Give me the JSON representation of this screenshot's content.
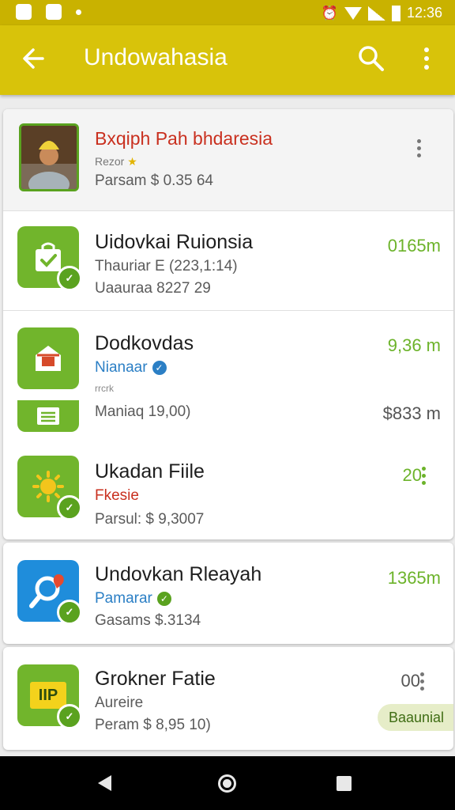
{
  "status_bar": {
    "time": "12:36"
  },
  "app_bar": {
    "title": "Undowahasia",
    "back_icon": "arrow-back-icon",
    "search_icon": "search-icon",
    "more_icon": "more-vert-icon"
  },
  "profile": {
    "name": "Bxqiph Pah bhdaresia",
    "sub": "Rezor",
    "price": "Parsam $ 0.35 64"
  },
  "group1": [
    {
      "name": "Uidovkai Ruionsia",
      "line2": "Thauriar E (223,1:14)",
      "line3": "Uaauraa 8227 29",
      "meta": "0165m",
      "icon": "shopping-bag-icon"
    },
    {
      "name": "Dodkovdas",
      "line2": "Nianaar",
      "line2b": "rrcrk",
      "line3": "Maniaq 19,00)",
      "meta": "9,36 m",
      "meta2": "$833 m",
      "icon": "store-icon"
    },
    {
      "name": "Ukadan Fiile",
      "line2": "Fkesie",
      "line3": "Parsul: $ 9,3007",
      "meta": "20",
      "icon": "sun-icon"
    }
  ],
  "card2": {
    "name": "Undovkan Rleayah",
    "line2": "Pamarar",
    "line3": "Gasams $.3134",
    "meta": "1365m",
    "icon": "location-search-icon"
  },
  "card3": {
    "name": "Grokner Fatie",
    "line2": "Aureire",
    "line3": "Peram $ 8,95 10)",
    "meta": "00",
    "pill": "Baaunial",
    "icon_text": "IIP"
  },
  "colors": {
    "app_bar": "#d8c30a",
    "status_bar": "#c9b200",
    "accent_green": "#6cb32a",
    "link_blue": "#2b7fc5",
    "nav_bar": "#000000"
  }
}
